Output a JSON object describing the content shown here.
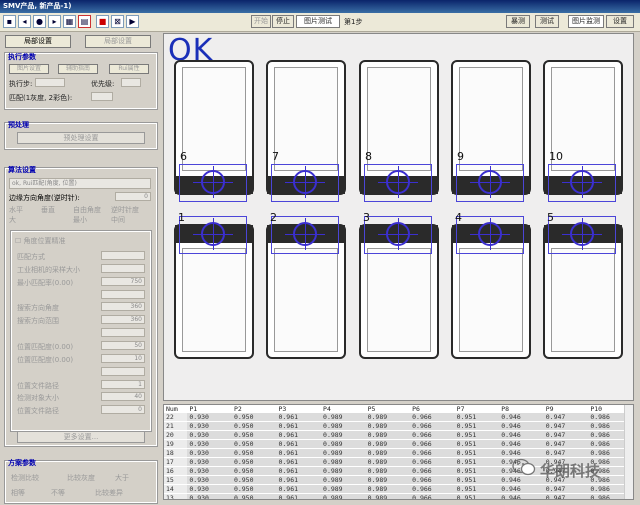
{
  "window": {
    "title": "SMV产品, 新产品-1)"
  },
  "toolbar": {
    "start_label": "开始",
    "stop_label": "停止",
    "image_test_label": "图片测试",
    "step_label": "第1步",
    "right_buttons": [
      "暴测",
      "测试",
      "图片监测",
      "设置"
    ]
  },
  "left": {
    "top_buttons": [
      "局部设置",
      "局部设置"
    ],
    "exec_params": {
      "title": "执行参数",
      "tabs": [
        "图片设置",
        "辅助指南",
        "Rui属性"
      ],
      "exec_step_label": "执行步:",
      "priority_label": "优先级:",
      "match_label": "匹配(1灰度, 2彩色):"
    },
    "preprocess": {
      "title": "预处理",
      "button_label": "预处理设置"
    },
    "algo": {
      "title": "算法设置",
      "dropdown": "ok, Rui匹配(角度, 位置)",
      "edge_label": "边缘方向角度(逆时针):",
      "edge_value": "0",
      "radio_labels": [
        "水平",
        "垂直",
        "自由角度",
        "逆时针度"
      ],
      "count_labels": [
        "大",
        "最小",
        "中间"
      ],
      "checkbox_label": "角度位置精准",
      "params": [
        {
          "label": "匹配方式",
          "value": ""
        },
        {
          "label": "工业相机的采样大小",
          "value": ""
        },
        {
          "label": "最小匹配率(0.00)",
          "value": "750"
        },
        {
          "label": "",
          "value": ""
        },
        {
          "label": "搜索方向角度",
          "value": "360"
        },
        {
          "label": "搜索方向范围",
          "value": "360"
        },
        {
          "label": "",
          "value": ""
        },
        {
          "label": "位置匹配度(0.00)",
          "value": "50"
        },
        {
          "label": "位置匹配度(0.00)",
          "value": "10"
        },
        {
          "label": "",
          "value": ""
        },
        {
          "label": "位置文件路径",
          "value": "1"
        },
        {
          "label": "检测对象大小",
          "value": "40"
        },
        {
          "label": "位置文件路径",
          "value": "0"
        }
      ],
      "more_button": "更多设置..."
    },
    "scheme": {
      "title": "方案参数",
      "options": [
        "检测比较",
        "比较灰度",
        "大于",
        "相等",
        "不等",
        "比较差异"
      ]
    }
  },
  "viewer": {
    "result": "OK",
    "top_numbers": [
      "6",
      "7",
      "8",
      "9",
      "10"
    ],
    "bottom_numbers": [
      "1",
      "2",
      "3",
      "4",
      "5"
    ]
  },
  "table": {
    "headers": [
      "Num",
      "P1",
      "P2",
      "P3",
      "P4",
      "P5",
      "P6",
      "P7",
      "P8",
      "P9",
      "P10"
    ],
    "rows": [
      [
        "22",
        "0.930",
        "0.950",
        "0.961",
        "0.989",
        "0.989",
        "0.966",
        "0.951",
        "0.946",
        "0.947",
        "0.986"
      ],
      [
        "21",
        "0.930",
        "0.950",
        "0.961",
        "0.989",
        "0.989",
        "0.966",
        "0.951",
        "0.946",
        "0.947",
        "0.986"
      ],
      [
        "20",
        "0.930",
        "0.950",
        "0.961",
        "0.989",
        "0.989",
        "0.966",
        "0.951",
        "0.946",
        "0.947",
        "0.986"
      ],
      [
        "19",
        "0.930",
        "0.950",
        "0.961",
        "0.989",
        "0.989",
        "0.966",
        "0.951",
        "0.946",
        "0.947",
        "0.986"
      ],
      [
        "18",
        "0.930",
        "0.950",
        "0.961",
        "0.989",
        "0.989",
        "0.966",
        "0.951",
        "0.946",
        "0.947",
        "0.986"
      ],
      [
        "17",
        "0.930",
        "0.950",
        "0.961",
        "0.989",
        "0.989",
        "0.966",
        "0.951",
        "0.946",
        "0.947",
        "0.986"
      ],
      [
        "16",
        "0.930",
        "0.950",
        "0.961",
        "0.989",
        "0.989",
        "0.966",
        "0.951",
        "0.946",
        "0.947",
        "0.986"
      ],
      [
        "15",
        "0.930",
        "0.950",
        "0.961",
        "0.989",
        "0.989",
        "0.966",
        "0.951",
        "0.946",
        "0.947",
        "0.986"
      ],
      [
        "14",
        "0.930",
        "0.950",
        "0.961",
        "0.989",
        "0.989",
        "0.966",
        "0.951",
        "0.946",
        "0.947",
        "0.986"
      ],
      [
        "13",
        "0.930",
        "0.950",
        "0.961",
        "0.989",
        "0.989",
        "0.966",
        "0.951",
        "0.946",
        "0.947",
        "0.986"
      ],
      [
        "12",
        "0.930",
        "0.950",
        "0.961",
        "0.989",
        "0.989",
        "0.966",
        "0.951",
        "0.946",
        "0.947",
        "0.986"
      ]
    ]
  },
  "watermark": {
    "text": "华朗科技"
  },
  "colors": {
    "result_ok": "#1a2fb8",
    "roi": "#4b45d8",
    "section_title": "#0000b0"
  }
}
